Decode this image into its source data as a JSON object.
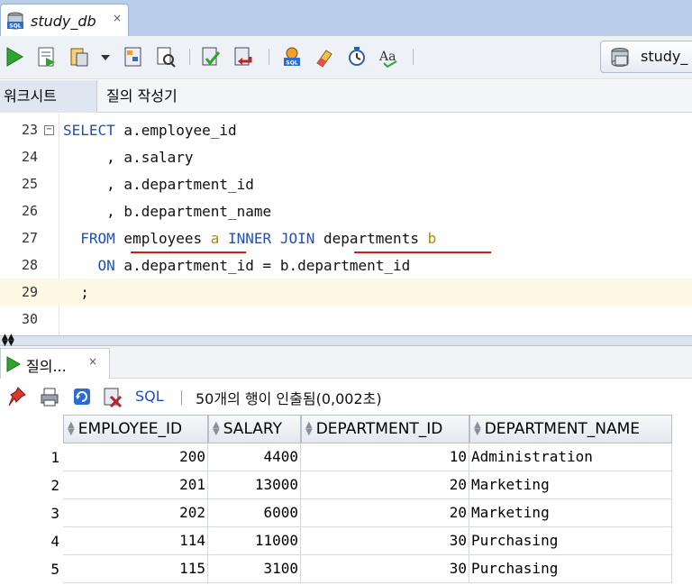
{
  "document_tab": {
    "title": "study_db",
    "close": "×",
    "icon": "sql-database-icon"
  },
  "toolbar": {
    "buttons": [
      "run-statement-icon",
      "run-script-icon",
      "autotrace-icon",
      "dropdown-arrow-icon",
      "explain-plan-icon",
      "sql-tuning-icon",
      "commit-icon",
      "rollback-icon",
      "sql-history-icon",
      "clear-icon",
      "sql-timer-icon",
      "text-case-icon"
    ],
    "connection": {
      "name": "study_",
      "icon": "database-connection-icon"
    }
  },
  "subtabs": {
    "worksheet": "워크시트",
    "query_builder": "질의 작성기"
  },
  "editor": {
    "lines": [
      {
        "num": "23",
        "fold": "−"
      },
      {
        "num": "24"
      },
      {
        "num": "25"
      },
      {
        "num": "26"
      },
      {
        "num": "27"
      },
      {
        "num": "28"
      },
      {
        "num": "29"
      },
      {
        "num": "30"
      }
    ],
    "tokens": {
      "l23_select": "SELECT",
      "l23_col": " a.employee_id",
      "l24": "     , a.salary",
      "l25": "     , a.department_id",
      "l26": "     , b.department_name",
      "l27_from": "  FROM",
      "l27_emp": " employees",
      "l27_a": " a",
      "l27_join": " INNER JOIN",
      "l27_dept": " departments",
      "l27_b": " b",
      "l28_on": "    ON",
      "l28_cond": " a.department_id = b.department_id",
      "l29": "  ;"
    }
  },
  "results": {
    "tab_label": "질의...",
    "tab_close": "×",
    "sql_link": "SQL",
    "status": "50개의 행이 인출됨(0,002초)",
    "columns": [
      "EMPLOYEE_ID",
      "SALARY",
      "DEPARTMENT_ID",
      "DEPARTMENT_NAME"
    ],
    "rows": [
      {
        "n": "1",
        "employee_id": "200",
        "salary": "4400",
        "department_id": "10",
        "department_name": "Administration"
      },
      {
        "n": "2",
        "employee_id": "201",
        "salary": "13000",
        "department_id": "20",
        "department_name": "Marketing"
      },
      {
        "n": "3",
        "employee_id": "202",
        "salary": "6000",
        "department_id": "20",
        "department_name": "Marketing"
      },
      {
        "n": "4",
        "employee_id": "114",
        "salary": "11000",
        "department_id": "30",
        "department_name": "Purchasing"
      },
      {
        "n": "5",
        "employee_id": "115",
        "salary": "3100",
        "department_id": "30",
        "department_name": "Purchasing"
      }
    ]
  },
  "colors": {
    "keyword": "#1f4fbf",
    "alias": "#b08a00",
    "annotation_underline": "#d41a1a",
    "current_line": "#fdf8e4"
  }
}
